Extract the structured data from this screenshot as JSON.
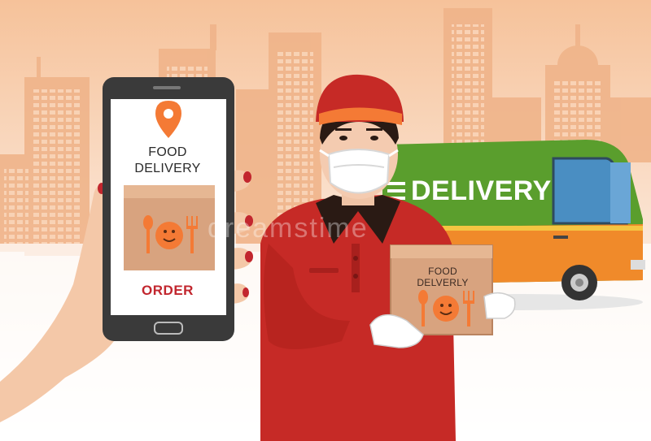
{
  "phone": {
    "title_line1": "FOOD",
    "title_line2": "DELIVERY",
    "button_label": "ORDER"
  },
  "van": {
    "label": "DELIVERY"
  },
  "box": {
    "label_line1": "FOOD",
    "label_line2": "DELVERLY"
  },
  "watermark": "dreamstime",
  "colors": {
    "sky_top": "#f6c59a",
    "building": "#f0b58b",
    "van_green": "#5a9e2d",
    "van_orange": "#f08a2a",
    "uniform_red": "#c62a26",
    "accent_orange": "#f47a35",
    "cardboard": "#d8a37f",
    "phone_body": "#3a3a3a"
  },
  "icons": [
    "location-pin-icon",
    "fork-icon",
    "knife-icon",
    "smiley-plate-icon"
  ]
}
